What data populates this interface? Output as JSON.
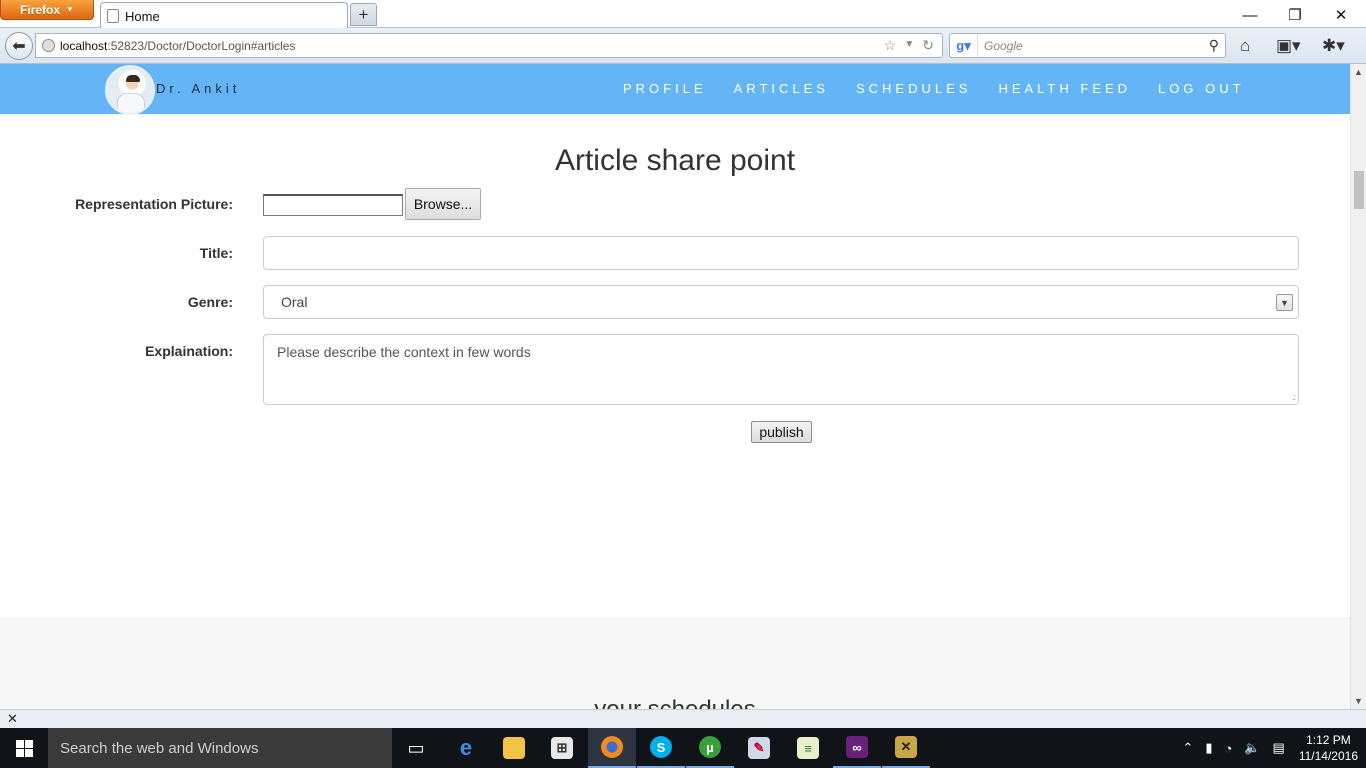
{
  "browser": {
    "app_button": "Firefox",
    "tab_title": "Home",
    "new_tab": "+",
    "url_host": "localhost",
    "url_path": ":52823/Doctor/DoctorLogin#articles",
    "search_placeholder": "Google",
    "window_controls": [
      "minimize",
      "restore",
      "close"
    ]
  },
  "site": {
    "doctor_name": "Dr. Ankit",
    "nav": [
      "PROFILE",
      "ARTICLES",
      "SCHEDULES",
      "HEALTH FEED",
      "LOG OUT"
    ]
  },
  "form": {
    "title": "Article share point",
    "picture_label": "Representation Picture:",
    "browse_label": "Browse...",
    "title_label": "Title:",
    "title_value": "",
    "genre_label": "Genre:",
    "genre_value": "Oral",
    "explanation_label": "Explaination:",
    "explanation_placeholder": "Please describe the context in few words",
    "publish_label": "publish"
  },
  "schedules": {
    "title": "your schedules"
  },
  "taskbar": {
    "search_placeholder": "Search the web and Windows",
    "time": "1:12 PM",
    "date": "11/14/2016"
  }
}
